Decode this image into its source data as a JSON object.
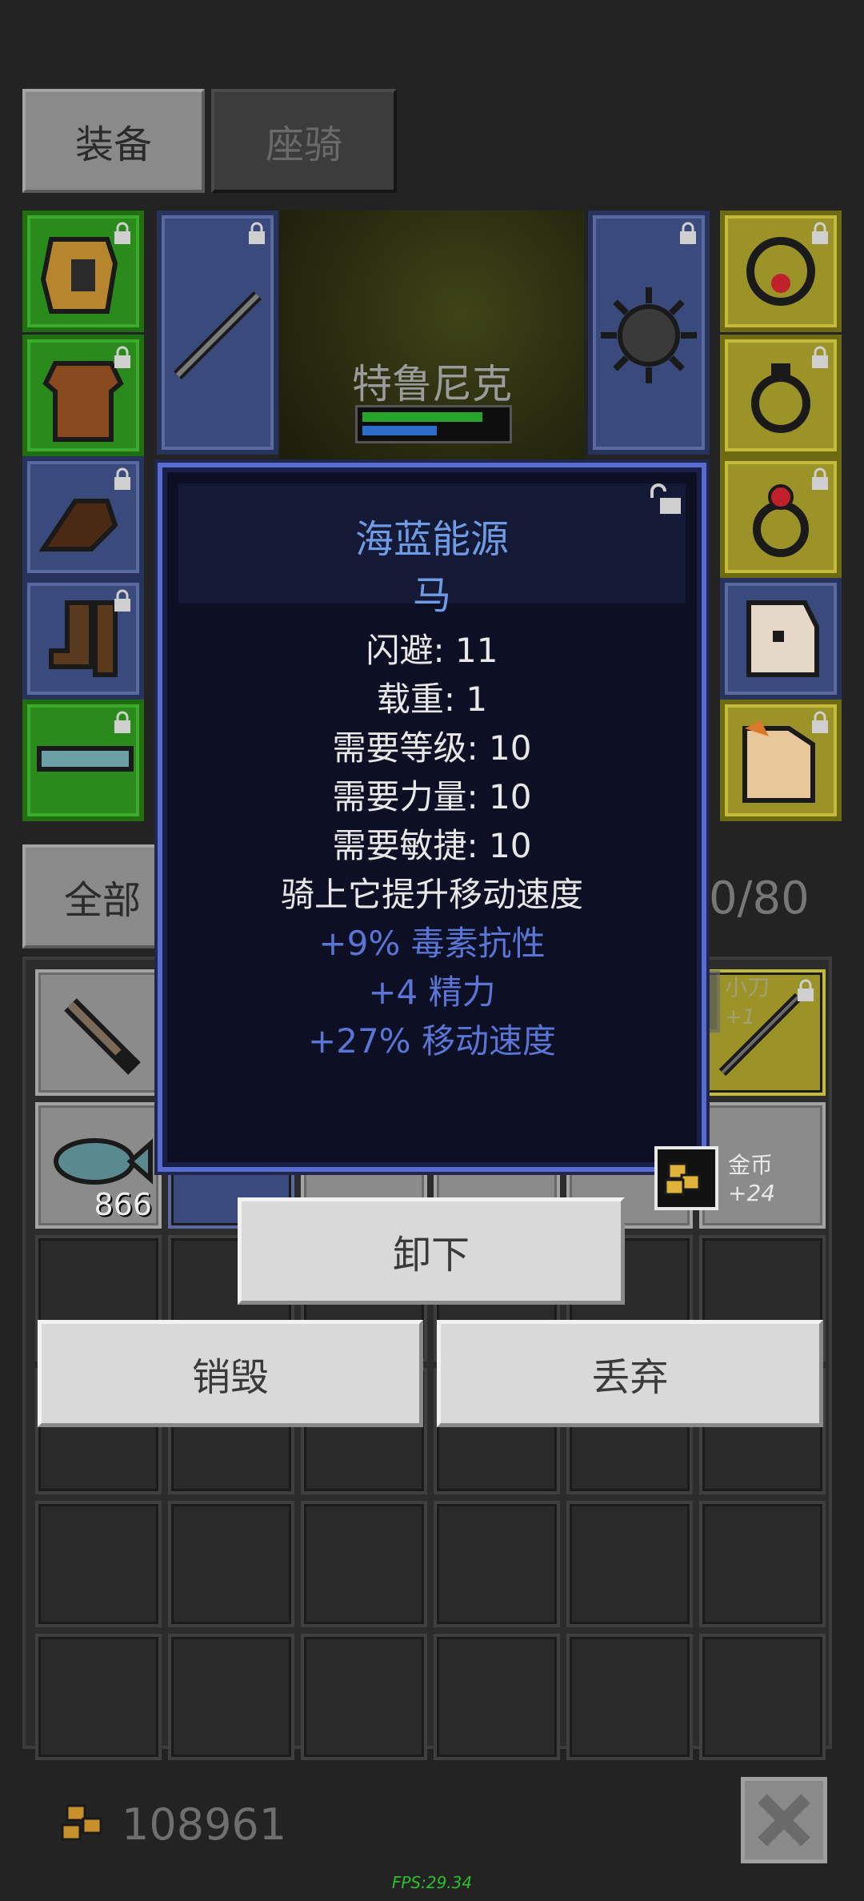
{
  "tabs": {
    "equipment": "装备",
    "mount": "座骑"
  },
  "character": {
    "name": "特鲁尼克",
    "hp_fraction": 0.85,
    "mp_fraction": 0.53
  },
  "filter": {
    "label": "全部"
  },
  "inventory": {
    "count_text": "0/80"
  },
  "tooltip": {
    "title": "海蓝能源",
    "subtitle": "马",
    "stats": [
      "闪避: 11",
      "载重: 1",
      "需要等级: 10",
      "需要力量: 10",
      "需要敏捷: 10",
      "骑上它提升移动速度"
    ],
    "bonuses": [
      "+9% 毒素抗性",
      "+4 精力",
      "+27% 移动速度"
    ]
  },
  "buttons": {
    "unequip": "卸下",
    "destroy": "销毁",
    "drop": "丢弃"
  },
  "items": {
    "fish_qty": "866"
  },
  "ghost_item": {
    "name": "小刀",
    "plus": "+1"
  },
  "gold_popup": {
    "label": "金币",
    "gain": "+24"
  },
  "footer": {
    "gold_total": "108961",
    "fps": "FPS:29.34"
  },
  "colors": {
    "rarity_green": "#2a8a1c",
    "rarity_blue": "#3b4a7c",
    "rarity_yellow": "#9b9228",
    "tooltip_border": "#5a6bd0",
    "bonus_blue": "#5b75d6"
  }
}
